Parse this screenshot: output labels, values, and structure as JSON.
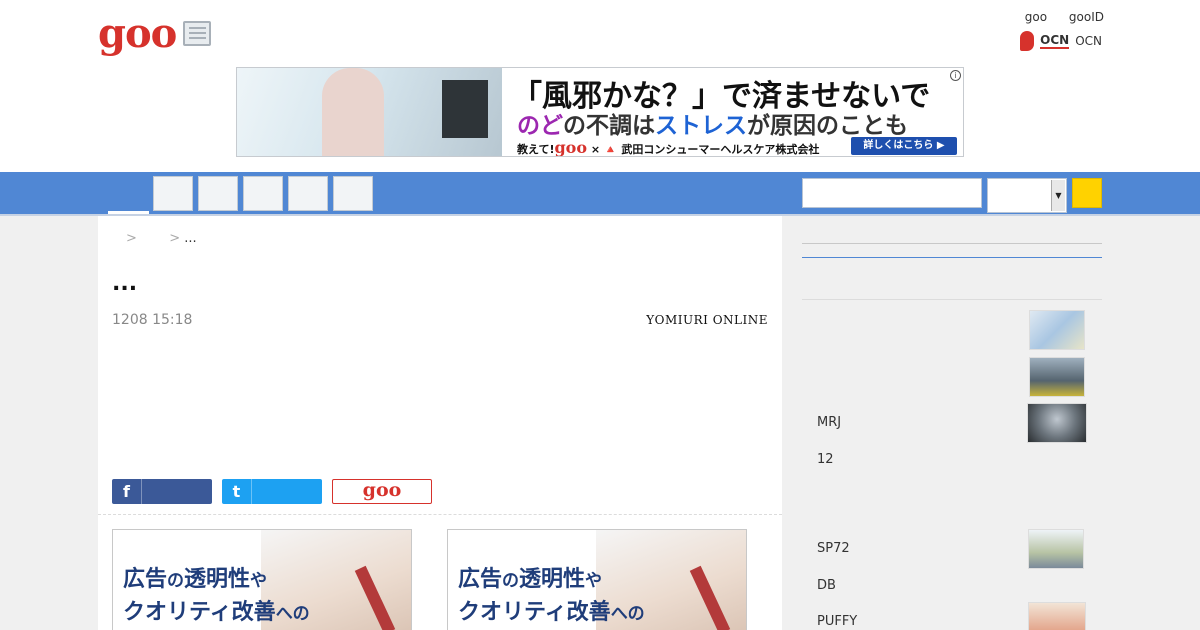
{
  "header": {
    "logo": "goo",
    "top_links": [
      "goo",
      "gooID"
    ],
    "ocn_mark": "OCN",
    "ocn_label": "OCN"
  },
  "ad": {
    "title": "「風邪かな？」で済ませないで",
    "sub_purple": "のど",
    "sub_mid1": "の不調は",
    "sub_blue": "ストレス",
    "sub_mid2": "が原因のことも",
    "footer_prefix": "教えて!",
    "footer_goo": "goo",
    "footer_sponsor": "× 🔺 武田コンシューマーヘルスケア株式会社",
    "cta": "詳しくはこちら ▶",
    "info": "i"
  },
  "breadcrumb": {
    "sep1": ">",
    "sep2": ">",
    "last": "..."
  },
  "article": {
    "title": "...",
    "date": "1208 15:18",
    "source": "YOMIURI ONLINE"
  },
  "share": {
    "facebook_icon": "f",
    "twitter_icon": "t",
    "goo_label": "goo"
  },
  "ad_cards": [
    {
      "line1a": "広告",
      "line1b": "の",
      "line1c": "透明性",
      "line1d": "や",
      "line2a": "クオリティ改善",
      "line2b": "への"
    },
    {
      "line1a": "広告",
      "line1b": "の",
      "line1c": "透明性",
      "line1d": "や",
      "line2a": "クオリティ改善",
      "line2b": "への"
    }
  ],
  "sidebar": {
    "items": [
      "MRJ",
      "12",
      "SP72",
      "DB",
      "PUFFY"
    ]
  },
  "icons": [
    "news-icon",
    "ocn-logo-icon",
    "facebook-icon",
    "twitter-icon",
    "dropdown-arrow-icon",
    "search-icon"
  ],
  "colors": {
    "brand": "#d6322c",
    "nav": "#5087d4",
    "search_button": "#ffd200",
    "facebook": "#3b5998",
    "twitter": "#1da1f2"
  }
}
